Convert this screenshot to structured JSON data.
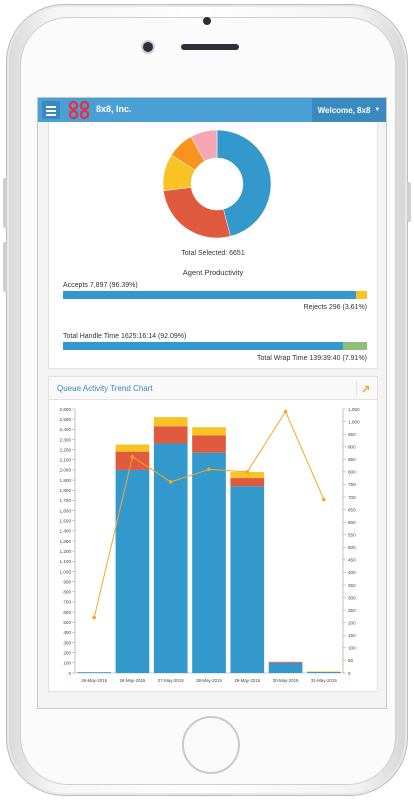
{
  "header": {
    "brand": "8x8, Inc.",
    "welcome": "Welcome, 8x8"
  },
  "summary": {
    "total_selected": "Total Selected: 6651",
    "agent_productivity": "Agent Productivity",
    "accepts": "Accepts 7,897 (96.39%)",
    "rejects": "Rejects 296 (3.61%)",
    "accepts_fraction": 0.9639,
    "handle_time": "Total Handle Time 1625:16:14 (92.09%)",
    "wrap_time": "Total Wrap Time 139:39:40 (7.91%)",
    "handle_fraction": 0.9209
  },
  "colors": {
    "blue": "#3399cc",
    "red": "#e05a3f",
    "yellow": "#f7c325",
    "orange": "#f7941d",
    "pink": "#f4a6b2",
    "green": "#8cc07a",
    "line": "#f5a623"
  },
  "queue_chart": {
    "title": "Queue Activity Trend Chart"
  },
  "chart_data": [
    {
      "type": "pie",
      "labels": [
        "",
        "",
        "",
        "",
        ""
      ],
      "values": [
        46,
        27,
        11,
        8,
        8
      ],
      "colors": [
        "#3399cc",
        "#e05a3f",
        "#f7c325",
        "#f7941d",
        "#f4a6b2"
      ]
    },
    {
      "type": "bar",
      "categories": [
        "26-May-2015",
        "26-May-2015",
        "27-May-2015",
        "28-May-2015",
        "29-May-2015",
        "30-May-2015",
        "31-May-2015"
      ],
      "series": [
        {
          "values": [
            8,
            2000,
            2260,
            2170,
            1840,
            100,
            10
          ],
          "color": "#3399cc"
        },
        {
          "values": [
            0,
            180,
            170,
            170,
            80,
            10,
            0
          ],
          "color": "#e05a3f"
        },
        {
          "values": [
            0,
            70,
            90,
            80,
            60,
            0,
            5
          ],
          "color": "#f7c325"
        }
      ],
      "line_series": {
        "values": [
          220,
          860,
          760,
          810,
          800,
          1040,
          690
        ],
        "color": "#f5a623",
        "axis": "right"
      },
      "ylim": [
        0,
        2600
      ],
      "y_ticks": [
        "0",
        "100",
        "200",
        "300",
        "400",
        "500",
        "600",
        "700",
        "800",
        "900",
        "1,000",
        "1,100",
        "1,200",
        "1,300",
        "1,400",
        "1,500",
        "1,600",
        "1,700",
        "1,800",
        "1,900",
        "2,000",
        "2,100",
        "2,200",
        "2,300",
        "2,400",
        "2,500",
        "2,600"
      ],
      "y2lim": [
        0,
        1050
      ],
      "y2_ticks": [
        "0",
        "50",
        "100",
        "150",
        "200",
        "250",
        "300",
        "350",
        "400",
        "450",
        "500",
        "550",
        "600",
        "650",
        "700",
        "750",
        "800",
        "850",
        "900",
        "950",
        "1,000",
        "1,050"
      ],
      "grid": false
    }
  ]
}
